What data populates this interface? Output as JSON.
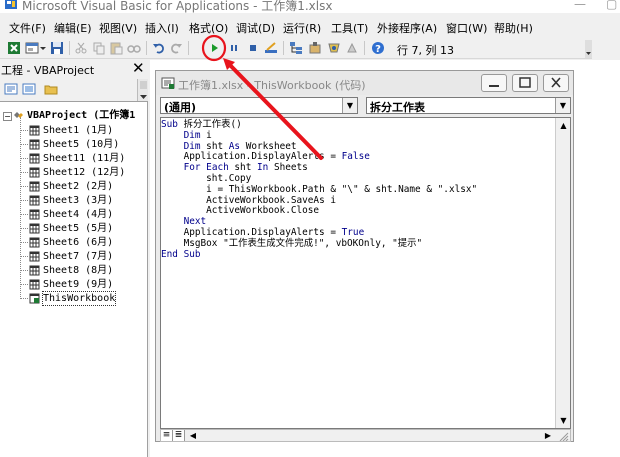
{
  "window": {
    "title": "Microsoft Visual Basic for Applications - 工作簿1.xlsx",
    "minimize_glyph": "—",
    "restore_glyph": "▢"
  },
  "menu": [
    {
      "label": "文件(F)",
      "name": "menu-file"
    },
    {
      "label": "编辑(E)",
      "name": "menu-edit"
    },
    {
      "label": "视图(V)",
      "name": "menu-view"
    },
    {
      "label": "插入(I)",
      "name": "menu-insert"
    },
    {
      "label": "格式(O)",
      "name": "menu-format"
    },
    {
      "label": "调试(D)",
      "name": "menu-debug"
    },
    {
      "label": "运行(R)",
      "name": "menu-run"
    },
    {
      "label": "工具(T)",
      "name": "menu-tools"
    },
    {
      "label": "外接程序(A)",
      "name": "menu-addins"
    },
    {
      "label": "窗口(W)",
      "name": "menu-window"
    },
    {
      "label": "帮助(H)",
      "name": "menu-help"
    }
  ],
  "toolbar": {
    "cursor_position": "行 7, 列 13",
    "icons": [
      "view-excel-icon",
      "insert-userform-icon",
      "save-icon",
      "cut-icon",
      "copy-icon",
      "paste-icon",
      "find-icon",
      "undo-icon",
      "redo-icon",
      "run-icon",
      "break-icon",
      "reset-icon",
      "design-mode-icon",
      "project-explorer-icon",
      "properties-icon",
      "object-browser-icon",
      "toolbox-icon",
      "help-icon"
    ]
  },
  "project_pane": {
    "title": "工程 - VBAProject",
    "close_glyph": "✕",
    "root": "VBAProject (工作簿1",
    "items": [
      "Sheet1 (1月)",
      "Sheet5 (10月)",
      "Sheet11 (11月)",
      "Sheet12 (12月)",
      "Sheet2 (2月)",
      "Sheet3 (3月)",
      "Sheet4 (4月)",
      "Sheet5 (5月)",
      "Sheet6 (6月)",
      "Sheet7 (7月)",
      "Sheet8 (8月)",
      "Sheet9 (9月)",
      "ThisWorkbook"
    ]
  },
  "code_window": {
    "title": "工作簿1.xlsx - ThisWorkbook (代码)",
    "object_combo": "(通用)",
    "procedure_combo": "拆分工作表",
    "code_lines": [
      "Sub 拆分工作表()",
      "    Dim i",
      "    Dim sht As Worksheet",
      "    Application.DisplayAlerts = False",
      "    For Each sht In Sheets",
      "        sht.Copy",
      "        i = ThisWorkbook.Path & \"\\\" & sht.Name & \".xlsx\"",
      "        ActiveWorkbook.SaveAs i",
      "        ActiveWorkbook.Close",
      "    Next",
      "    Application.DisplayAlerts = True",
      "    MsgBox \"工作表生成文件完成!\", vbOKOnly, \"提示\"",
      "End Sub"
    ]
  },
  "annotation": {
    "color": "#e8141c"
  }
}
